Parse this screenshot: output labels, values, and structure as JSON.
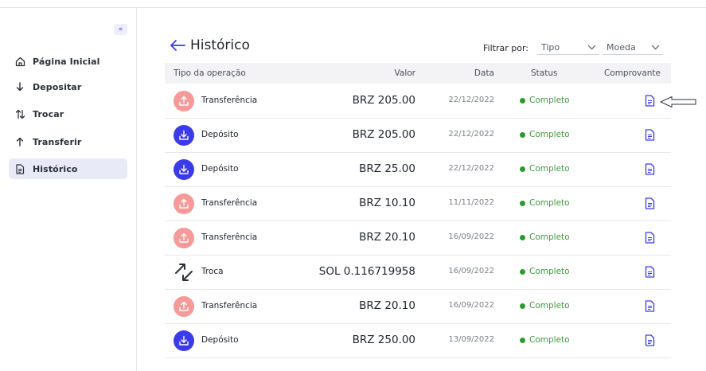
{
  "sidebar": {
    "collapse_glyph": "«",
    "items": [
      {
        "label": "Página Inicial",
        "icon": "home-icon",
        "active": false
      },
      {
        "label": "Depositar",
        "icon": "arrow-down-icon",
        "active": false
      },
      {
        "label": "Trocar",
        "icon": "swap-vertical-icon",
        "active": false
      },
      {
        "label": "Transferir",
        "icon": "arrow-up-icon",
        "active": false
      },
      {
        "label": "Histórico",
        "icon": "document-icon",
        "active": true
      }
    ]
  },
  "header": {
    "title": "Histórico",
    "back_icon": "arrow-left-icon"
  },
  "filters": {
    "label": "Filtrar por:",
    "type_select": "Tipo",
    "currency_select": "Moeda"
  },
  "table": {
    "columns": {
      "operation": "Tipo da operação",
      "value": "Valor",
      "date": "Data",
      "status": "Status",
      "receipt": "Comprovante"
    },
    "rows": [
      {
        "type": "Transferência",
        "kind": "out",
        "value": "BRZ 205.00",
        "date": "22/12/2022",
        "status": "Completo"
      },
      {
        "type": "Depósito",
        "kind": "in",
        "value": "BRZ 205.00",
        "date": "22/12/2022",
        "status": "Completo"
      },
      {
        "type": "Depósito",
        "kind": "in",
        "value": "BRZ 25.00",
        "date": "22/12/2022",
        "status": "Completo"
      },
      {
        "type": "Transferência",
        "kind": "out",
        "value": "BRZ 10.10",
        "date": "11/11/2022",
        "status": "Completo"
      },
      {
        "type": "Transferência",
        "kind": "out",
        "value": "BRZ 20.10",
        "date": "16/09/2022",
        "status": "Completo"
      },
      {
        "type": "Troca",
        "kind": "swap",
        "value": "SOL 0.116719958",
        "date": "16/09/2022",
        "status": "Completo"
      },
      {
        "type": "Transferência",
        "kind": "out",
        "value": "BRZ 20.10",
        "date": "16/09/2022",
        "status": "Completo"
      },
      {
        "type": "Depósito",
        "kind": "in",
        "value": "BRZ 250.00",
        "date": "13/09/2022",
        "status": "Completo"
      }
    ]
  },
  "colors": {
    "accent": "#3b3bea",
    "transfer": "#f59a98",
    "status_ok": "#2e9a2e"
  }
}
